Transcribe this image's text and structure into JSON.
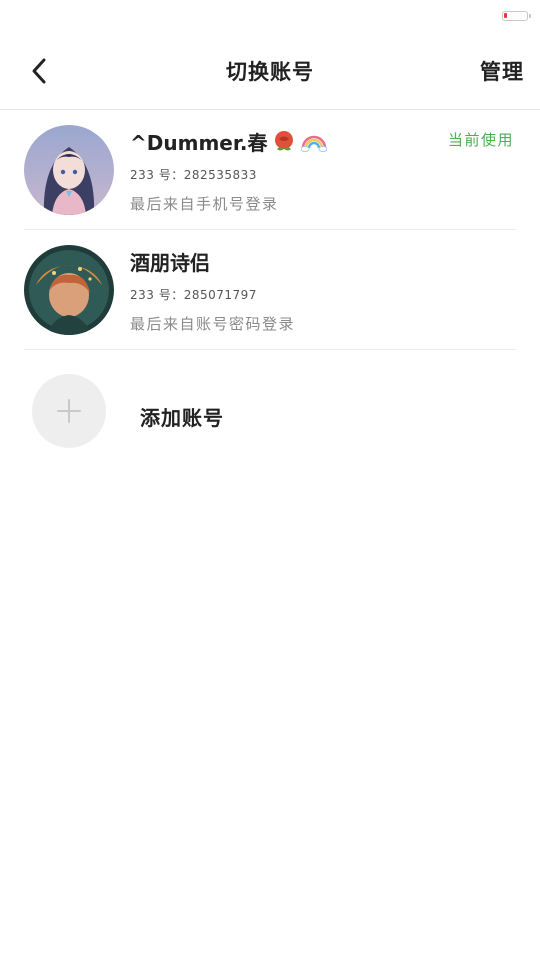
{
  "status_bar": {
    "battery_icon": "battery-low-icon",
    "battery_color": "#e53935"
  },
  "header": {
    "back_icon": "chevron-left-icon",
    "title": "切换账号",
    "manage_label": "管理"
  },
  "accounts": [
    {
      "name": "^Dummer.春",
      "name_emojis": [
        "rose-emoji",
        "rainbow-emoji"
      ],
      "id_text": "233 号：282535833",
      "login_text": "最后来自手机号登录",
      "current_label": "当前使用"
    },
    {
      "name": "酒朋诗侣",
      "id_text": "233 号：285071797",
      "login_text": "最后来自账号密码登录"
    }
  ],
  "add_account": {
    "icon": "plus-icon",
    "label": "添加账号"
  },
  "colors": {
    "accent_green": "#4caf50",
    "divider": "#ececec"
  }
}
